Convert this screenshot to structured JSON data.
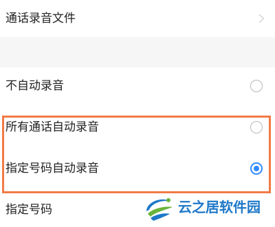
{
  "settings": {
    "call_recording_files": "通话录音文件",
    "options": [
      {
        "label": "不自动录音",
        "selected": false
      },
      {
        "label": "所有通话自动录音",
        "selected": false
      },
      {
        "label": "指定号码自动录音",
        "selected": true
      }
    ],
    "specified_numbers": "指定号码"
  },
  "watermark": {
    "text": "云之居软件园"
  },
  "colors": {
    "accent_blue": "#2e8bff",
    "highlight_orange": "#f27a45",
    "watermark_blue": "#1e78c8",
    "watermark_green": "#6ab43c"
  }
}
